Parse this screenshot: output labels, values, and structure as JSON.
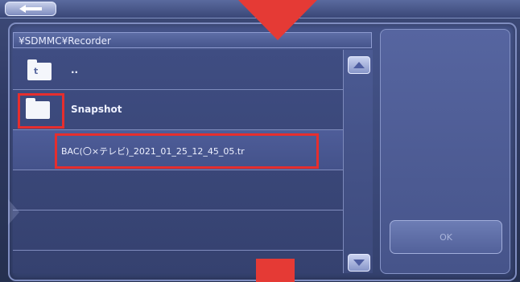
{
  "top_bar": {
    "back_icon": "left-arrow-icon"
  },
  "path": "¥SDMMC¥Recorder",
  "files": [
    {
      "label": "..",
      "type": "parent-folder",
      "icon": "folder-up-icon"
    },
    {
      "label": "Snapshot",
      "type": "folder",
      "icon": "folder-icon"
    },
    {
      "label": "BAC(〇×テレビ)_2021_01_25_12_45_05.tr",
      "type": "file"
    },
    {
      "label": "",
      "type": "empty"
    },
    {
      "label": "",
      "type": "empty"
    }
  ],
  "ok_label": "OK",
  "scroll": {
    "up_icon": "scroll-up-icon",
    "down_icon": "scroll-down-icon"
  },
  "colors": {
    "highlight": "#e62e2e",
    "overlay_red": "#e53a35",
    "panel": "#3f4d82"
  }
}
